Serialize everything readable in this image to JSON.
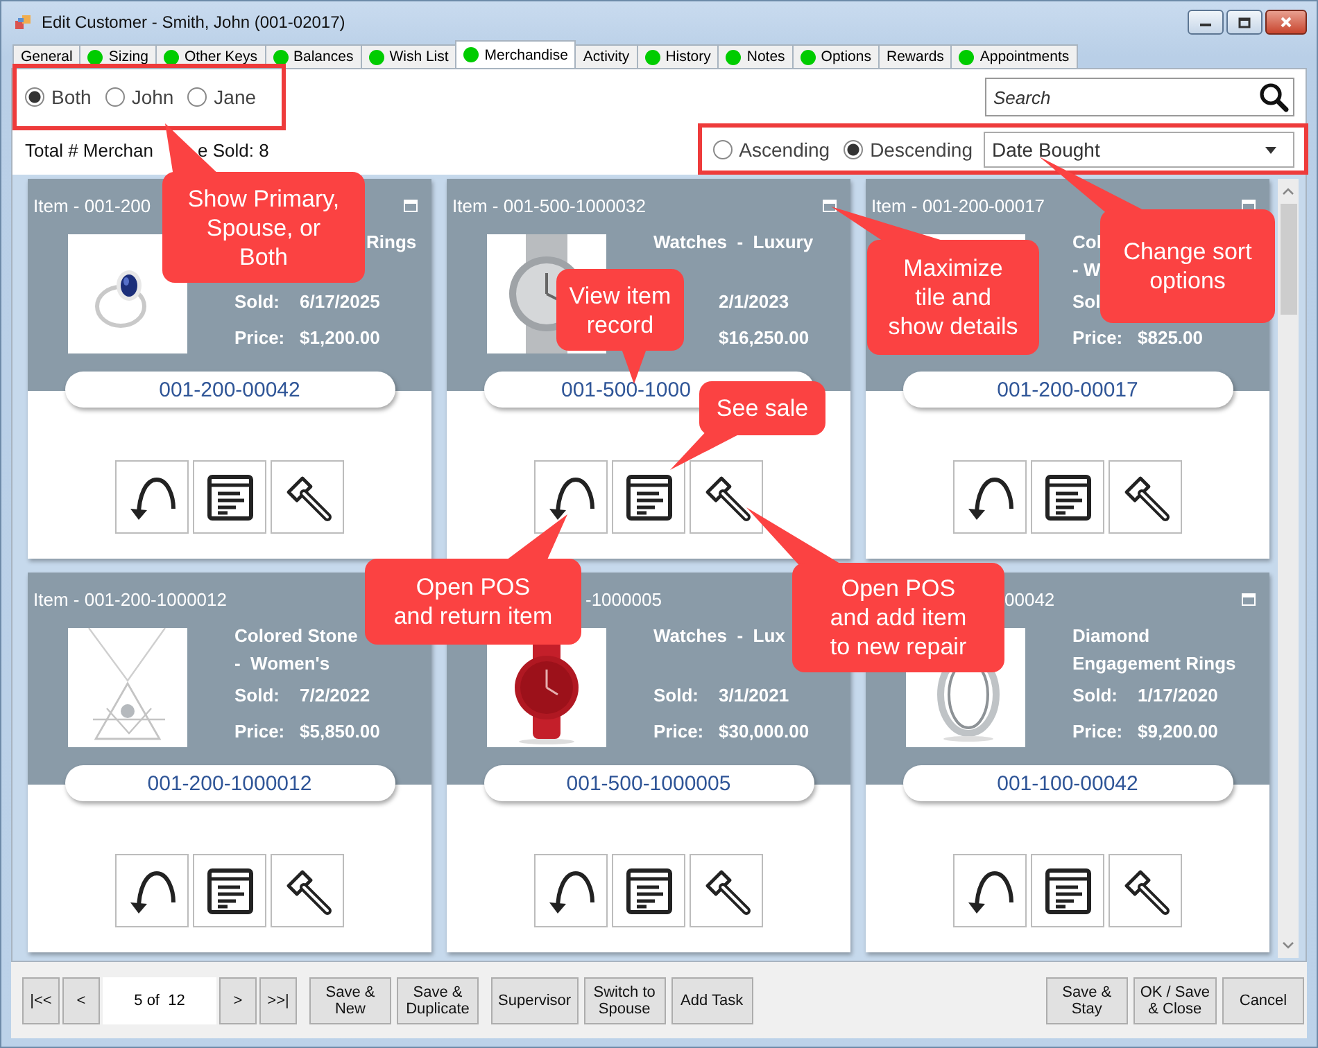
{
  "window": {
    "title": "Edit Customer - Smith, John (001-02017)"
  },
  "tabs": [
    {
      "label": "General",
      "indicator": false,
      "selected": false
    },
    {
      "label": "Sizing",
      "indicator": true,
      "selected": false
    },
    {
      "label": "Other Keys",
      "indicator": true,
      "selected": false
    },
    {
      "label": "Balances",
      "indicator": true,
      "selected": false
    },
    {
      "label": "Wish List",
      "indicator": true,
      "selected": false
    },
    {
      "label": "Merchandise",
      "indicator": true,
      "selected": true
    },
    {
      "label": "Activity",
      "indicator": false,
      "selected": false
    },
    {
      "label": "History",
      "indicator": true,
      "selected": false
    },
    {
      "label": "Notes",
      "indicator": true,
      "selected": false
    },
    {
      "label": "Options",
      "indicator": true,
      "selected": false
    },
    {
      "label": "Rewards",
      "indicator": false,
      "selected": false
    },
    {
      "label": "Appointments",
      "indicator": true,
      "selected": false
    }
  ],
  "owner_filter": [
    {
      "label": "Both",
      "selected": true
    },
    {
      "label": "John",
      "selected": false
    },
    {
      "label": "Jane",
      "selected": false
    }
  ],
  "search": {
    "placeholder": "Search"
  },
  "total": [
    "Total # Merchan",
    "e Sold: 8"
  ],
  "sort": {
    "order": [
      {
        "label": "Ascending",
        "selected": false
      },
      {
        "label": "Descending",
        "selected": true
      }
    ],
    "field": "Date Bought"
  },
  "tiles": [
    {
      "header": "Item - 001-200",
      "maximize_button": true,
      "category": [
        "Rings"
      ],
      "category_start_hidden": true,
      "sold": {
        "label": "Sold:",
        "value": "6/17/2025"
      },
      "price": {
        "label": "Price:",
        "value": "$1,200.00"
      },
      "link": "001-200-00042",
      "link_end_hidden": false,
      "kind": "picture"
    },
    {
      "header": "Item - 001-500-1000032",
      "maximize_button": true,
      "category": [
        "Watches  -  Luxury"
      ],
      "category_start_hidden": false,
      "sold": {
        "value": "2/1/2023"
      },
      "price": {
        "value": "$16,250.00"
      },
      "link": "001-500-1000",
      "link_end_hidden": true,
      "kind": "picture"
    },
    {
      "header": "Item - 001-200-00017",
      "maximize_button": true,
      "category": [
        "Col",
        "- W"
      ],
      "category_start_hidden": false,
      "sold": {
        "label": "Sol"
      },
      "price": {
        "label": "Price:",
        "value": "$825.00"
      },
      "link": "001-200-00017",
      "link_end_hidden": false,
      "kind": "picture"
    },
    {
      "header": "Item - 001-200-1000012",
      "maximize_button": false,
      "category": [
        "Colored Stone",
        "-  Women's"
      ],
      "category_start_hidden": false,
      "sold": {
        "label": "Sold:",
        "value": "7/2/2022"
      },
      "price": {
        "label": "Price:",
        "value": "$5,850.00"
      },
      "link": "001-200-1000012",
      "link_end_hidden": false,
      "kind": "picture"
    },
    {
      "header": "-1000005",
      "header_start_hidden": true,
      "maximize_button": false,
      "category": [
        "Watches  -  Lux"
      ],
      "category_start_hidden": false,
      "sold": {
        "label": "Sold:",
        "value": "3/1/2021"
      },
      "price": {
        "label": "Price:",
        "value": "$30,000.00"
      },
      "link": "001-500-1000005",
      "link_end_hidden": false,
      "kind": "picture"
    },
    {
      "header": "00042",
      "header_start_hidden": true,
      "maximize_button": true,
      "category": [
        "Diamond",
        "Engagement Rings"
      ],
      "category_start_hidden": false,
      "sold": {
        "label": "Sold:",
        "value": "1/17/2020"
      },
      "price": {
        "label": "Price:",
        "value": "$9,200.00"
      },
      "link": "001-100-00042",
      "link_end_hidden": false,
      "kind": "picture"
    }
  ],
  "pager": {
    "first": "|<<",
    "previous": "<",
    "position": "5 of  12",
    "next": ">",
    "last": ">>|"
  },
  "record_buttons": [
    "Save &\nNew",
    "Save &\nDuplicate"
  ],
  "action_buttons": [
    "Supervisor",
    "Switch to\nSpouse",
    "Add Task"
  ],
  "close_buttons": [
    "Save &\nStay",
    "OK / Save\n& Close",
    "Cancel"
  ],
  "callouts": [
    "Show Primary,\nSpouse, or\nBoth",
    "View item\nrecord",
    "Maximize\ntile and\nshow details",
    "Change sort\noptions",
    "See sale",
    "Open POS\nand return item",
    "Open POS\nand add item\nto new repair"
  ]
}
